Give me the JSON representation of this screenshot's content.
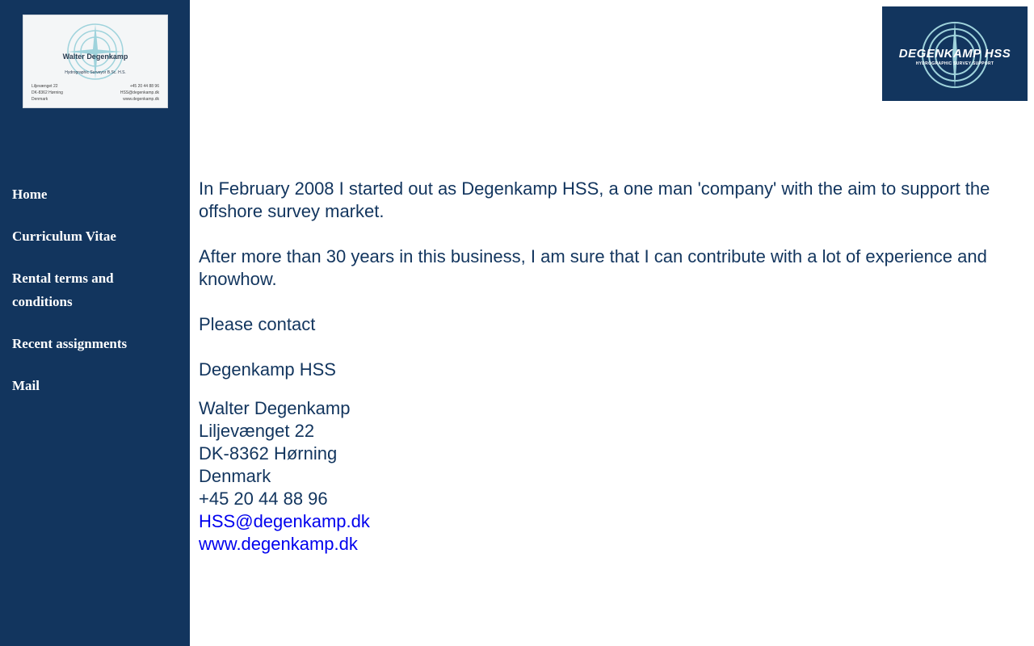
{
  "business_card": {
    "name": "Walter Degenkamp",
    "title": "Hydrographic Surveyor B.Sc. H.S.",
    "address": [
      "Liljevænget 22",
      "DK-8362 Hørning",
      "Denmark"
    ],
    "contact": [
      "+45 20 44 88 96",
      "HSS@degenkamp.dk",
      "www.degenkamp.dk"
    ]
  },
  "nav": {
    "items": [
      {
        "label": "Home"
      },
      {
        "label": "Curriculum Vitae"
      },
      {
        "label": "Rental terms and conditions"
      },
      {
        "label": "Recent assignments"
      },
      {
        "label": "Mail"
      }
    ]
  },
  "logo": {
    "text": "DEGENKAMP HSS",
    "subtitle": "HYDROGRAPHIC SURVEY SUPPORT"
  },
  "content": {
    "paragraph1": "In February 2008 I started out as Degenkamp HSS, a one man 'company' with the aim to support the offshore survey market.",
    "paragraph2": "After more than 30 years in this business, I am sure that I can contribute with a lot of experience and knowhow.",
    "paragraph3": "Please contact",
    "company": "Degenkamp HSS",
    "contact_name": "Walter Degenkamp",
    "street": "Liljevænget 22",
    "city": "DK-8362 Hørning",
    "country": "Denmark",
    "phone": "+45 20 44 88 96",
    "email": "HSS@degenkamp.dk",
    "website": "www.degenkamp.dk"
  },
  "colors": {
    "sidebar": "#12355e",
    "text": "#12355e",
    "link": "#0000ee"
  }
}
